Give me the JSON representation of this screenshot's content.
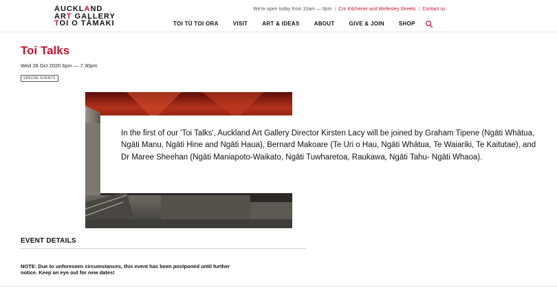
{
  "logo": {
    "line1_a": "AUCKL",
    "line1_b": "A",
    "line1_c": "ND",
    "line2_a": "AR",
    "line2_b": "T",
    "line2_c": " GALLERY",
    "line3_a": "T",
    "line3_b": "OI O TĀMAKI"
  },
  "notice": {
    "hours": "We're open today from 10am — 9pm",
    "address": "Cnr Kitchener and Wellesley Streets",
    "contact": "Contact us",
    "separator": "|"
  },
  "nav": {
    "items": [
      {
        "label": "TOI TŪ TOI ORA"
      },
      {
        "label": "VISIT"
      },
      {
        "label": "ART & IDEAS"
      },
      {
        "label": "ABOUT"
      },
      {
        "label": "GIVE & JOIN"
      },
      {
        "label": "SHOP"
      }
    ],
    "search_icon": "search-icon"
  },
  "event": {
    "title": "Toi Talks",
    "datetime": "Wed 28 Oct 2020 6pm — 7.30pm",
    "tag": "SPECIAL EVENTS",
    "description": "In the first of our 'Toi Talks', Auckland Art Gallery Director Kirsten Lacy will be joined by Graham Tipene (Ngāti Whātua, Ngāti Manu, Ngāti Hine and Ngāti Haua), Bernard Makoare (Te Uri o Hau, Ngāti Whātua, Te Waiariki, Te Kaitutae), and Dr Maree Sheehan (Ngāti Maniapoto-Waikato, Ngāti Tuwharetoa, Raukawa, Ngāti Tahu- Ngāti Whaoa)."
  },
  "details": {
    "heading": "EVENT DETAILS",
    "note": "NOTE: Due to unforeseen circumstances, this event has been postponed until further notice. Keep an eye out for new dates!"
  },
  "colors": {
    "accent": "#c8102e",
    "text": "#111111"
  }
}
